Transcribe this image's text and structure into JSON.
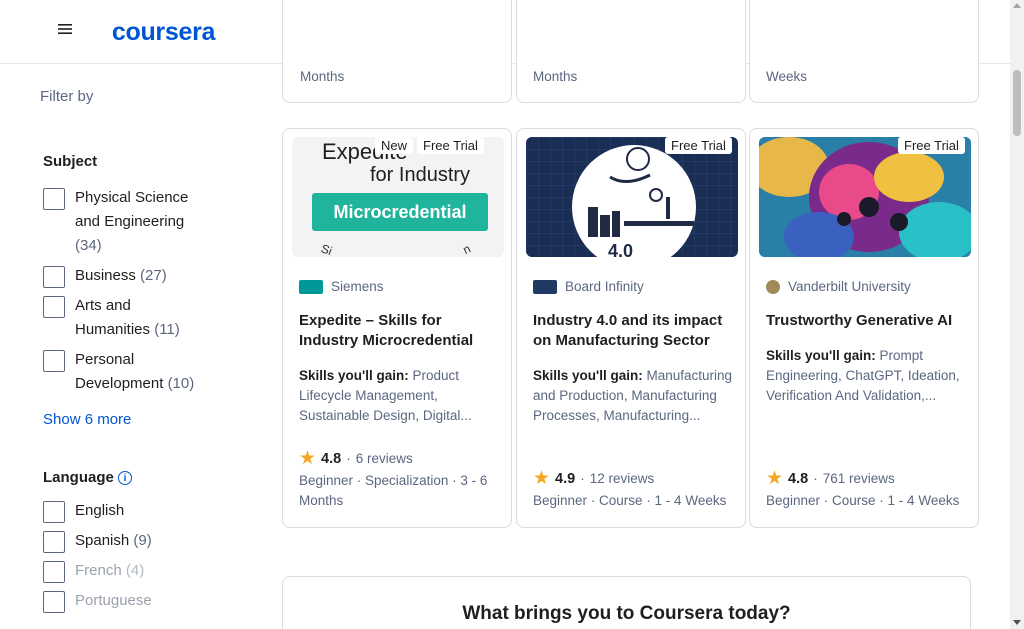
{
  "header": {
    "logo_text": "coursera",
    "brand_color": "#0056d2"
  },
  "sidebar": {
    "filter_by": "Filter by",
    "subject_title": "Subject",
    "subjects": [
      {
        "label": "Physical Science and Engineering",
        "count": "(34)"
      },
      {
        "label": "Business",
        "count": "(27)"
      },
      {
        "label": "Arts and Humanities",
        "count": "(11)"
      },
      {
        "label": "Personal Development",
        "count": "(10)"
      }
    ],
    "show_more": "Show 6 more",
    "language_title": "Language",
    "language_info_icon": "info-icon",
    "languages": [
      {
        "label": "English",
        "count": ""
      },
      {
        "label": "Spanish",
        "count": "(9)"
      },
      {
        "label": "French",
        "count": "(4)"
      },
      {
        "label": "Portuguese",
        "count": ""
      }
    ]
  },
  "top_cards": [
    "Months",
    "Months",
    "Weeks"
  ],
  "cards": [
    {
      "badges": [
        "New",
        "Free Trial"
      ],
      "image_text_1": "Expedite",
      "image_text_2": "for Industry",
      "image_band": "Microcredential",
      "partner": "Siemens",
      "partner_logo_color": "#009999",
      "title": "Expedite – Skills for Industry Microcredential",
      "skills_label": "Skills you'll gain:",
      "skills": "Product Lifecycle Management, Sustainable Design, Digital...",
      "rating": "4.8",
      "reviews": "6 reviews",
      "meta": "Beginner · Specialization · 3 - 6 Months"
    },
    {
      "badges": [
        "Free Trial"
      ],
      "image_label": "4.0",
      "partner": "Board Infinity",
      "partner_logo_color": "#1f3b63",
      "title": "Industry 4.0 and its impact on Manufacturing Sector",
      "skills_label": "Skills you'll gain:",
      "skills": "Manufacturing and Production, Manufacturing Processes, Manufacturing...",
      "rating": "4.9",
      "reviews": "12 reviews",
      "meta": "Beginner · Course · 1 - 4 Weeks"
    },
    {
      "badges": [
        "Free Trial"
      ],
      "partner": "Vanderbilt University",
      "partner_logo_color": "#a08a5a",
      "title": "Trustworthy Generative AI",
      "skills_label": "Skills you'll gain:",
      "skills": "Prompt Engineering, ChatGPT, Ideation, Verification And Validation,...",
      "rating": "4.8",
      "reviews": "761 reviews",
      "meta": "Beginner · Course · 1 - 4 Weeks"
    }
  ],
  "bring_section": {
    "title": "What brings you to Coursera today?"
  }
}
